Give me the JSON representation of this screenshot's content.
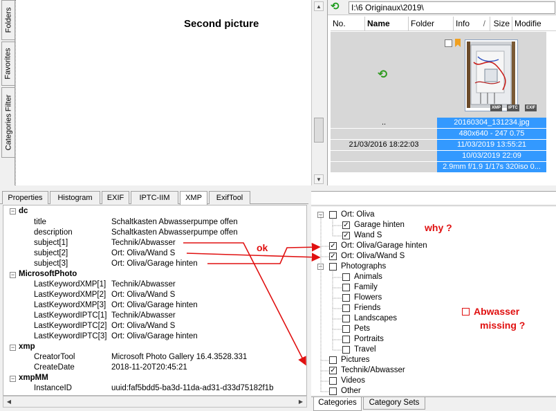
{
  "side_tabs": [
    "Folders",
    "Favorites",
    "Categories Filter"
  ],
  "preview": {
    "title": "Second picture"
  },
  "explorer": {
    "path": "I:\\6 Originaux\\2019\\",
    "columns": [
      "No.",
      "Name",
      "Folder",
      "Info",
      "Size",
      "Modifie"
    ],
    "sort_glyph": "/",
    "parent_name": "..",
    "parent_date": "21/03/2016 18:22:03",
    "badges": [
      "XMP",
      "IPTC",
      "EXIF"
    ],
    "file_info": [
      "20160304_131234.jpg",
      "480x640 - 247 0.75",
      "11/03/2019 13:55:21",
      "10/03/2019 22:09",
      "2.9mm f/1.9 1/17s 320iso 0..."
    ]
  },
  "properties": {
    "tabs": [
      "Properties",
      "Histogram",
      "EXIF",
      "IPTC-IIM",
      "XMP",
      "ExifTool"
    ],
    "active_tab": "XMP",
    "groups": [
      {
        "name": "dc",
        "rows": [
          {
            "key": "title",
            "value": "Schaltkasten Abwasserpumpe offen"
          },
          {
            "key": "description",
            "value": "Schaltkasten Abwasserpumpe offen"
          },
          {
            "key": "subject[1]",
            "value": "Technik/Abwasser"
          },
          {
            "key": "subject[2]",
            "value": "Ort: Oliva/Wand S"
          },
          {
            "key": "subject[3]",
            "value": "Ort: Oliva/Garage hinten"
          }
        ]
      },
      {
        "name": "MicrosoftPhoto",
        "rows": [
          {
            "key": "LastKeywordXMP[1]",
            "value": "Technik/Abwasser"
          },
          {
            "key": "LastKeywordXMP[2]",
            "value": "Ort: Oliva/Wand S"
          },
          {
            "key": "LastKeywordXMP[3]",
            "value": "Ort: Oliva/Garage hinten"
          },
          {
            "key": "LastKeywordIPTC[1]",
            "value": "Technik/Abwasser"
          },
          {
            "key": "LastKeywordIPTC[2]",
            "value": "Ort: Oliva/Wand S"
          },
          {
            "key": "LastKeywordIPTC[3]",
            "value": "Ort: Oliva/Garage hinten"
          }
        ]
      },
      {
        "name": "xmp",
        "rows": [
          {
            "key": "CreatorTool",
            "value": "Microsoft Photo Gallery 16.4.3528.331"
          },
          {
            "key": "CreateDate",
            "value": "2018-11-20T20:45:21"
          }
        ]
      },
      {
        "name": "xmpMM",
        "rows": [
          {
            "key": "InstanceID",
            "value": "uuid:faf5bdd5-ba3d-11da-ad31-d33d75182f1b"
          }
        ]
      }
    ]
  },
  "categories": {
    "items": [
      {
        "label": "Ort: Oliva",
        "checked": false,
        "level": 0,
        "expander": "-"
      },
      {
        "label": "Garage hinten",
        "checked": true,
        "level": 1
      },
      {
        "label": "Wand S",
        "checked": true,
        "level": 1
      },
      {
        "label": "Ort: Oliva/Garage hinten",
        "checked": true,
        "level": 0
      },
      {
        "label": "Ort: Oliva/Wand S",
        "checked": true,
        "level": 0
      },
      {
        "label": "Photographs",
        "checked": false,
        "level": 0,
        "expander": "-"
      },
      {
        "label": "Animals",
        "checked": false,
        "level": 1
      },
      {
        "label": "Family",
        "checked": false,
        "level": 1
      },
      {
        "label": "Flowers",
        "checked": false,
        "level": 1
      },
      {
        "label": "Friends",
        "checked": false,
        "level": 1
      },
      {
        "label": "Landscapes",
        "checked": false,
        "level": 1
      },
      {
        "label": "Pets",
        "checked": false,
        "level": 1
      },
      {
        "label": "Portraits",
        "checked": false,
        "level": 1
      },
      {
        "label": "Travel",
        "checked": false,
        "level": 1
      },
      {
        "label": "Pictures",
        "checked": false,
        "level": 0
      },
      {
        "label": "Technik/Abwasser",
        "checked": true,
        "level": 0
      },
      {
        "label": "Videos",
        "checked": false,
        "level": 0
      },
      {
        "label": "Other",
        "checked": false,
        "level": 0
      }
    ],
    "bottom_tabs": [
      "Categories",
      "Category Sets"
    ],
    "active_tab": "Categories"
  },
  "annotations": {
    "ok": "ok",
    "why": "why ?",
    "abwasser_line1": "Abwasser",
    "abwasser_line2": "missing ?",
    "color": "#e01010"
  }
}
